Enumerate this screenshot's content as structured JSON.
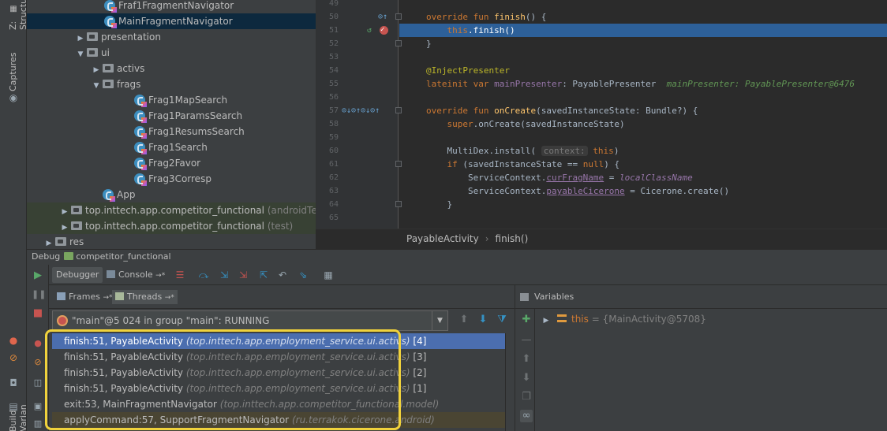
{
  "left_strip": {
    "tabs": [
      "Z: Structure",
      "Captures",
      "Build Variants"
    ]
  },
  "project_tree": {
    "rows": [
      {
        "label": "Fraf1FragmentNavigator",
        "suffix": "",
        "kind": "class",
        "indent": 86,
        "arrow": ""
      },
      {
        "label": "MainFragmentNavigator",
        "suffix": "",
        "kind": "class",
        "indent": 86,
        "arrow": "",
        "selected": true
      },
      {
        "label": "presentation",
        "suffix": "",
        "kind": "folder",
        "indent": 62,
        "arrow": "▶"
      },
      {
        "label": "ui",
        "suffix": "",
        "kind": "folder",
        "indent": 62,
        "arrow": "▼"
      },
      {
        "label": "activs",
        "suffix": "",
        "kind": "folder",
        "indent": 82,
        "arrow": "▶"
      },
      {
        "label": "frags",
        "suffix": "",
        "kind": "folder",
        "indent": 82,
        "arrow": "▼"
      },
      {
        "label": "Frag1MapSearch",
        "suffix": "",
        "kind": "class",
        "indent": 124,
        "arrow": ""
      },
      {
        "label": "Frag1ParamsSearch",
        "suffix": "",
        "kind": "class",
        "indent": 124,
        "arrow": ""
      },
      {
        "label": "Frag1ResumsSearch",
        "suffix": "",
        "kind": "class",
        "indent": 124,
        "arrow": ""
      },
      {
        "label": "Frag1Search",
        "suffix": "",
        "kind": "class",
        "indent": 124,
        "arrow": ""
      },
      {
        "label": "Frag2Favor",
        "suffix": "",
        "kind": "class",
        "indent": 124,
        "arrow": ""
      },
      {
        "label": "Frag3Corresp",
        "suffix": "",
        "kind": "class",
        "indent": 124,
        "arrow": ""
      },
      {
        "label": "App",
        "suffix": "",
        "kind": "class",
        "indent": 84,
        "arrow": ""
      },
      {
        "label": "top.inttech.app.competitor_functional",
        "suffix": " (androidTest)",
        "kind": "folder",
        "indent": 42,
        "arrow": "▶",
        "testsrc": true
      },
      {
        "label": "top.inttech.app.competitor_functional",
        "suffix": " (test)",
        "kind": "folder",
        "indent": 42,
        "arrow": "▶",
        "testsrc": true
      },
      {
        "label": "res",
        "suffix": "",
        "kind": "folder",
        "indent": 22,
        "arrow": "▶"
      }
    ]
  },
  "editor": {
    "lines": [
      {
        "num": "49",
        "html": ""
      },
      {
        "num": "50",
        "html": "<span class=\"kw\">override fun </span><span class=\"fn\">finish</span>() {",
        "marks": "o↑",
        "fold": true
      },
      {
        "num": "51",
        "html": "    <span class=\"kw\">this</span>.finish()",
        "marks": "bp",
        "exec": true
      },
      {
        "num": "52",
        "html": "}",
        "fold": true
      },
      {
        "num": "53",
        "html": ""
      },
      {
        "num": "54",
        "html": "<span class=\"ann\">@InjectPresenter</span>"
      },
      {
        "num": "55",
        "html": "<span class=\"kw\">lateinit var </span><span class=\"prop\" style=\"font-style:normal\">mainPresenter</span>: PayablePresenter  <span class=\"inline-val\">mainPresenter: PayablePresenter@6476</span>"
      },
      {
        "num": "56",
        "html": ""
      },
      {
        "num": "57",
        "html": "<span class=\"kw\">override fun </span><span class=\"fn\">onCreate</span>(savedInstanceState: Bundle?) {",
        "marks": "multi",
        "fold": true
      },
      {
        "num": "58",
        "html": "    <span class=\"kw\">super</span>.onCreate(savedInstanceState)"
      },
      {
        "num": "59",
        "html": ""
      },
      {
        "num": "60",
        "html": "    MultiDex.install( <span class=\"hint\">context:</span> <span class=\"kw\">this</span>)"
      },
      {
        "num": "61",
        "html": "    <span class=\"kw\">if </span>(savedInstanceState == <span class=\"kw\">null</span>) {",
        "fold": true
      },
      {
        "num": "62",
        "html": "        ServiceContext.<span class=\"prop ul\" style=\"font-style:normal\">curFragName</span> = <span class=\"prop\">localClassName</span>"
      },
      {
        "num": "63",
        "html": "        ServiceContext.<span class=\"prop ul\" style=\"font-style:normal\">payableCicerone</span> = Cicerone.create()"
      },
      {
        "num": "64",
        "html": "    }",
        "fold": true
      },
      {
        "num": "65",
        "html": ""
      }
    ]
  },
  "breadcrumb": {
    "class_name": "PayableActivity",
    "separator": "›",
    "method_name": "finish()"
  },
  "debug": {
    "title": "Debug",
    "config_name": "competitor_functional",
    "tabs": {
      "debugger": "Debugger",
      "console": "Console",
      "console_suffix": "→*"
    },
    "frames_tab": "Frames",
    "frames_suffix": "→*",
    "threads_tab": "Threads",
    "threads_suffix": "→*",
    "thread_selector": "\"main\"@5 024 in group \"main\": RUNNING",
    "frames": [
      {
        "method": "finish:51, PayableActivity",
        "pkg": "(top.inttech.app.employment_service.ui.activs)",
        "idx": "[4]",
        "selected": true
      },
      {
        "method": "finish:51, PayableActivity",
        "pkg": "(top.inttech.app.employment_service.ui.activs)",
        "idx": "[3]"
      },
      {
        "method": "finish:51, PayableActivity",
        "pkg": "(top.inttech.app.employment_service.ui.activs)",
        "idx": "[2]"
      },
      {
        "method": "finish:51, PayableActivity",
        "pkg": "(top.inttech.app.employment_service.ui.activs)",
        "idx": "[1]"
      },
      {
        "method": "exit:53, MainFragmentNavigator",
        "pkg": "(top.inttech.app.competitor_functional.model)",
        "idx": ""
      },
      {
        "method": "applyCommand:57, SupportFragmentNavigator",
        "pkg": "(ru.terrakok.cicerone.android)",
        "idx": "",
        "lib": true
      }
    ],
    "variables_title": "Variables",
    "variables": [
      {
        "name": "this",
        "value": "= {MainActivity@5708}"
      }
    ]
  },
  "colors": {
    "highlight_box": "#f0d23c",
    "selected_frame": "#4b6eaf",
    "exec_line": "#2d6099"
  }
}
